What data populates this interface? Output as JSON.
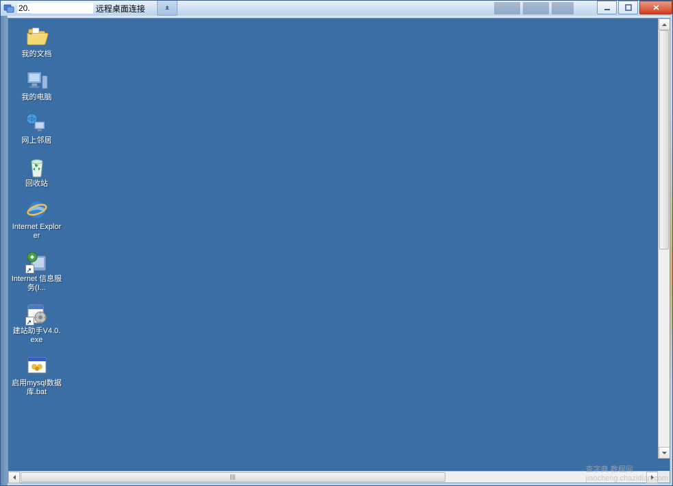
{
  "window": {
    "title_prefix": "20.",
    "title_suffix": "远程桌面连接"
  },
  "desktop": {
    "icons": [
      {
        "id": "my-documents",
        "label": "我的文档"
      },
      {
        "id": "my-computer",
        "label": "我的电脑"
      },
      {
        "id": "network-neighborhood",
        "label": "网上邻居"
      },
      {
        "id": "recycle-bin",
        "label": "回收站"
      },
      {
        "id": "internet-explorer",
        "label": "Internet Explorer"
      },
      {
        "id": "iis",
        "label": "Internet 信息服务(I..."
      },
      {
        "id": "site-helper",
        "label": "建站助手V4.0.exe"
      },
      {
        "id": "mysql-bat",
        "label": "启用mysql数据库.bat"
      }
    ]
  },
  "watermark": {
    "brand": "查字典 教程网",
    "url": "jiaocheng.chazidian.com"
  }
}
